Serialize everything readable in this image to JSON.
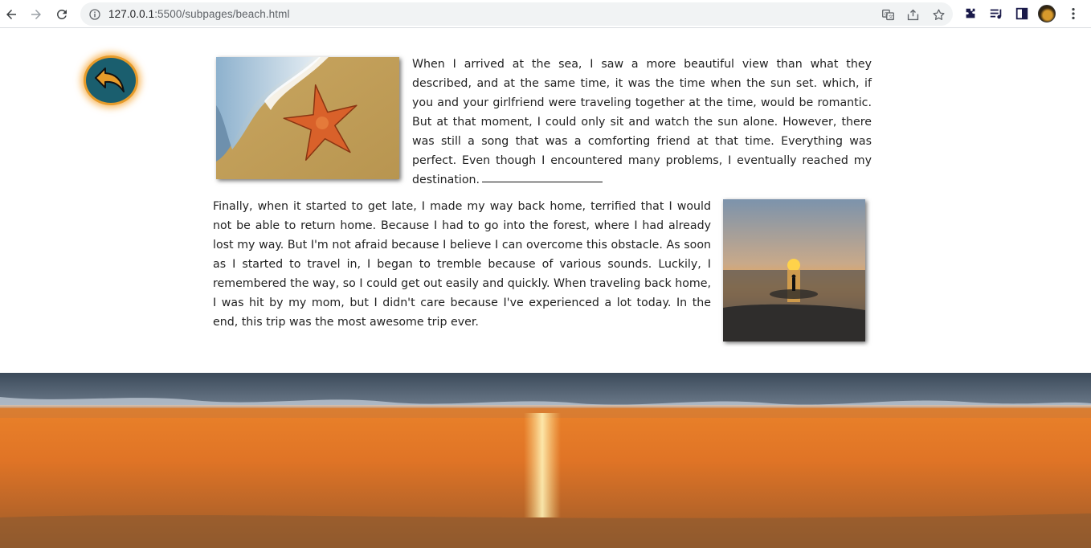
{
  "browser": {
    "url_host": "127.0.0.1",
    "url_path": ":5500/subpages/beach.html"
  },
  "page": {
    "back_button": {
      "icon": "reply-arrow-icon",
      "color": "#1a5e6e",
      "ring_color": "#e69b2a"
    },
    "paragraphs": [
      "When I arrived at the sea, I saw a more beautiful view than what they described, and at the same time, it was the time when the sun set. which, if you and your girlfriend were traveling together at the time, would be romantic. But at that moment, I could only sit and watch the sun alone. However, there was still a song that was a comforting friend at that time. Everything was perfect. Even though I encountered many problems, I eventually reached my destination.",
      "Finally, when it started to get late, I made my way back home, terrified that I would not be able to return home. Because I had to go into the forest, where I had already lost my way. But I'm not afraid because I believe I can overcome this obstacle. As soon as I started to travel in, I began to tremble because of various sounds. Luckily, I remembered the way, so I could get out easily and quickly. When traveling back home, I was hit by my mom, but I didn't care because I've experienced a lot today. In the end, this trip was the most awesome trip ever."
    ]
  }
}
